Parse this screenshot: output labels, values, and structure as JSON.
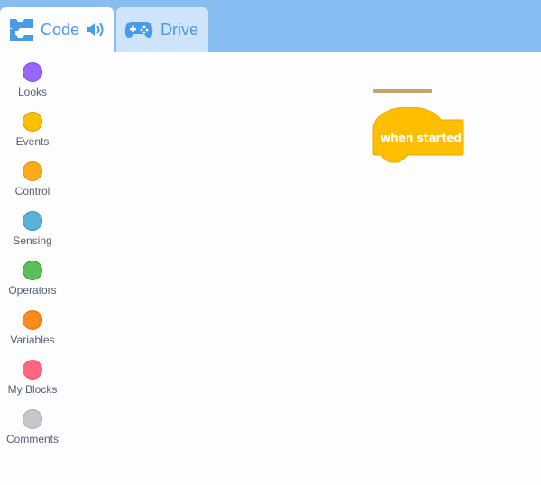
{
  "tabs": [
    {
      "label": "Code",
      "active": true
    },
    {
      "label": "Drive",
      "active": false
    }
  ],
  "categories": [
    {
      "label": "Looks",
      "color": "#9966ff"
    },
    {
      "label": "Events",
      "color": "#ffbf00"
    },
    {
      "label": "Control",
      "color": "#ffab19"
    },
    {
      "label": "Sensing",
      "color": "#5cb1d6"
    },
    {
      "label": "Operators",
      "color": "#59c059"
    },
    {
      "label": "Variables",
      "color": "#ff8c1a"
    },
    {
      "label": "My Blocks",
      "color": "#ff6680"
    },
    {
      "label": "Comments",
      "color": "#c6c6cc"
    }
  ],
  "workspace": {
    "hat_block": {
      "label": "when started",
      "color": "#ffbf00"
    }
  },
  "icons": {
    "code_tab": "code-blocks-icon",
    "sound": "speaker-icon",
    "drive_tab": "gamepad-icon"
  },
  "colors": {
    "topbar": "#87bdf0",
    "tab_text": "#4a9be6"
  }
}
